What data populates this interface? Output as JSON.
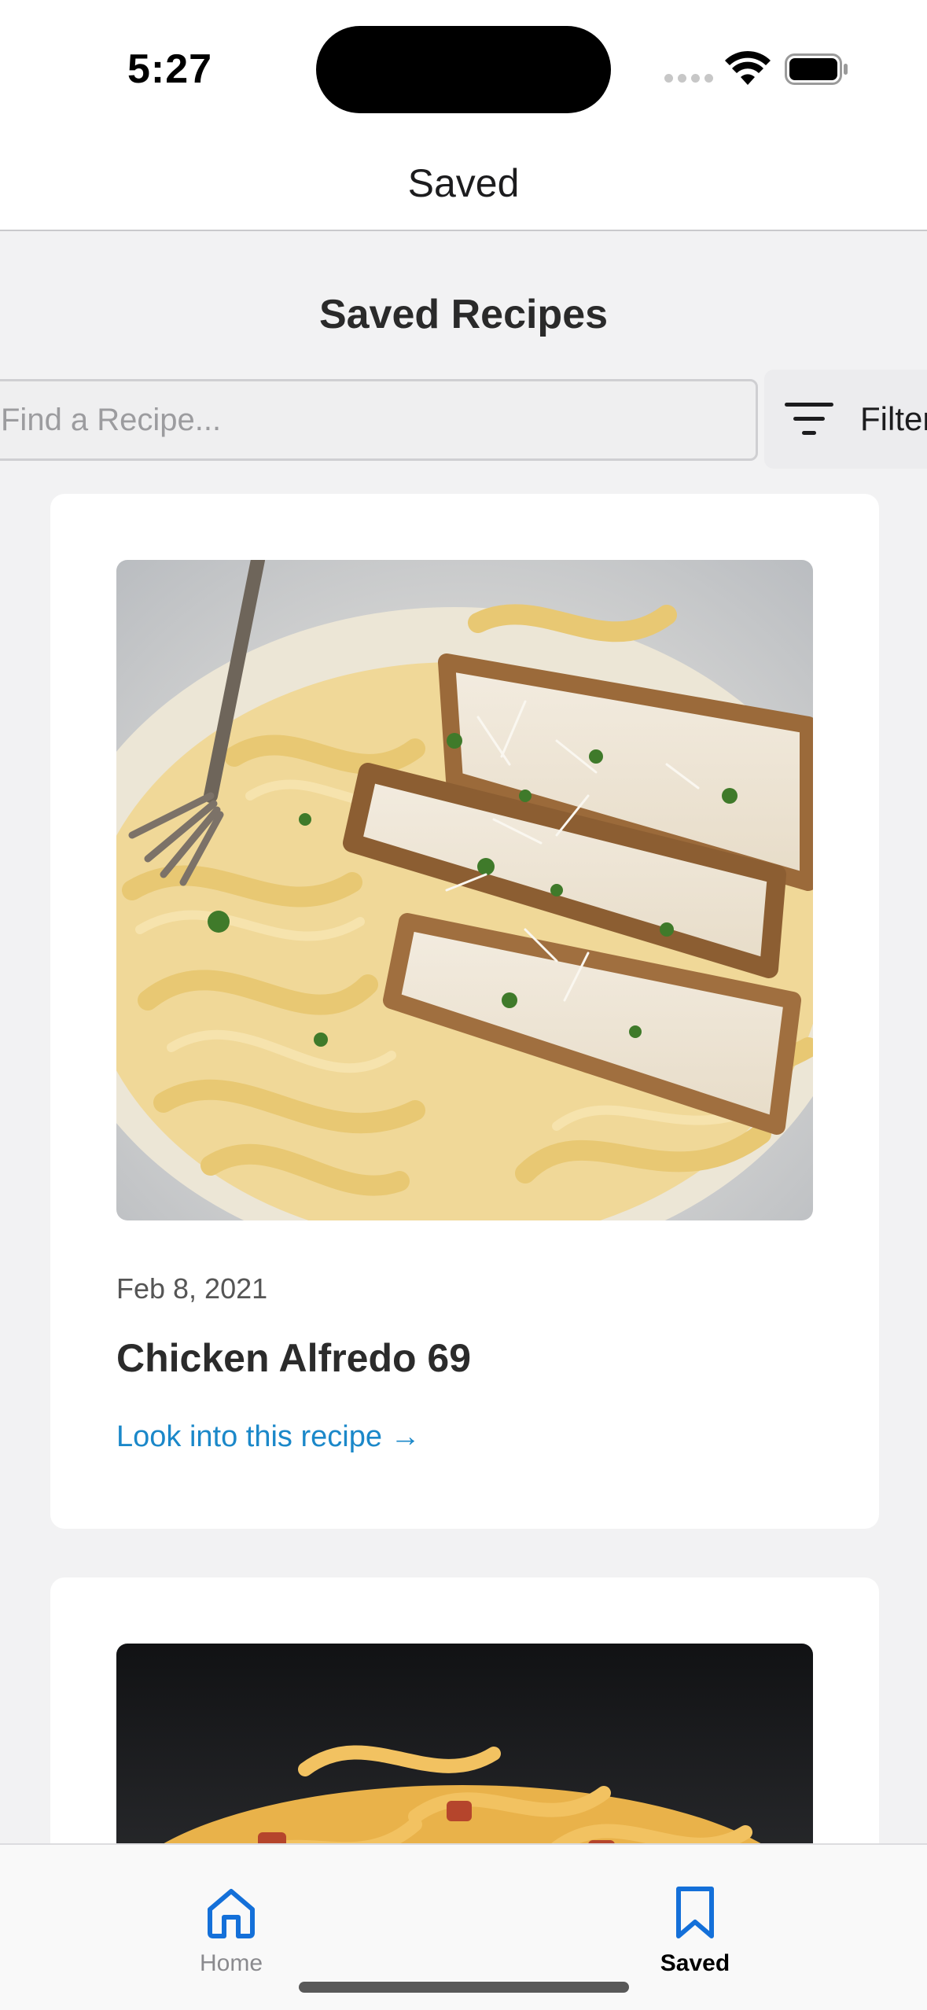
{
  "status_bar": {
    "time": "5:27",
    "icons": [
      "signal-icon",
      "wifi-icon",
      "battery-icon"
    ]
  },
  "header": {
    "title": "Saved"
  },
  "page": {
    "title": "Saved Recipes"
  },
  "search": {
    "placeholder": "Find a Recipe...",
    "value": ""
  },
  "filter": {
    "label": "Filter",
    "icon": "filter-icon"
  },
  "recipes": [
    {
      "date": "Feb 8, 2021",
      "title": "Chicken Alfredo 69",
      "link_label": "Look into this recipe →",
      "image": "chicken-alfredo-photo"
    },
    {
      "date": "",
      "title": "",
      "link_label": "",
      "image": "pasta-carbonara-photo"
    }
  ],
  "tabs": [
    {
      "label": "Home",
      "icon": "home-icon",
      "active": false
    },
    {
      "label": "Saved",
      "icon": "bookmark-icon",
      "active": true
    }
  ],
  "colors": {
    "accent_blue": "#1b88c9",
    "tab_active_icon": "#1470d9",
    "background": "#f2f2f3",
    "card": "#ffffff"
  }
}
